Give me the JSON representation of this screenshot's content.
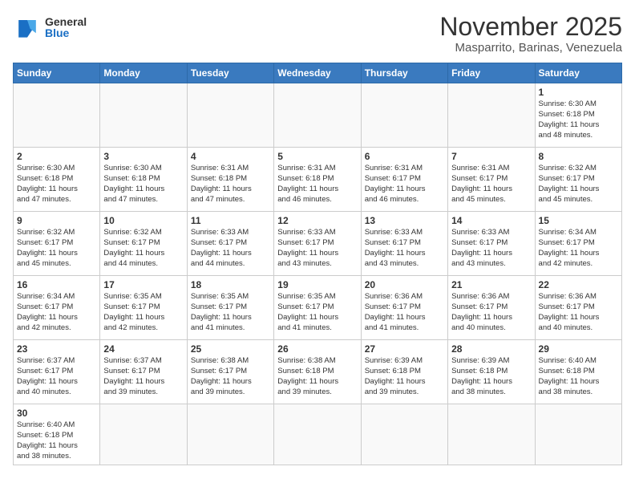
{
  "logo": {
    "general": "General",
    "blue": "Blue"
  },
  "header": {
    "month": "November 2025",
    "location": "Masparrito, Barinas, Venezuela"
  },
  "weekdays": [
    "Sunday",
    "Monday",
    "Tuesday",
    "Wednesday",
    "Thursday",
    "Friday",
    "Saturday"
  ],
  "weeks": [
    [
      {
        "day": "",
        "info": ""
      },
      {
        "day": "",
        "info": ""
      },
      {
        "day": "",
        "info": ""
      },
      {
        "day": "",
        "info": ""
      },
      {
        "day": "",
        "info": ""
      },
      {
        "day": "",
        "info": ""
      },
      {
        "day": "1",
        "info": "Sunrise: 6:30 AM\nSunset: 6:18 PM\nDaylight: 11 hours\nand 48 minutes."
      }
    ],
    [
      {
        "day": "2",
        "info": "Sunrise: 6:30 AM\nSunset: 6:18 PM\nDaylight: 11 hours\nand 47 minutes."
      },
      {
        "day": "3",
        "info": "Sunrise: 6:30 AM\nSunset: 6:18 PM\nDaylight: 11 hours\nand 47 minutes."
      },
      {
        "day": "4",
        "info": "Sunrise: 6:31 AM\nSunset: 6:18 PM\nDaylight: 11 hours\nand 47 minutes."
      },
      {
        "day": "5",
        "info": "Sunrise: 6:31 AM\nSunset: 6:18 PM\nDaylight: 11 hours\nand 46 minutes."
      },
      {
        "day": "6",
        "info": "Sunrise: 6:31 AM\nSunset: 6:17 PM\nDaylight: 11 hours\nand 46 minutes."
      },
      {
        "day": "7",
        "info": "Sunrise: 6:31 AM\nSunset: 6:17 PM\nDaylight: 11 hours\nand 45 minutes."
      },
      {
        "day": "8",
        "info": "Sunrise: 6:32 AM\nSunset: 6:17 PM\nDaylight: 11 hours\nand 45 minutes."
      }
    ],
    [
      {
        "day": "9",
        "info": "Sunrise: 6:32 AM\nSunset: 6:17 PM\nDaylight: 11 hours\nand 45 minutes."
      },
      {
        "day": "10",
        "info": "Sunrise: 6:32 AM\nSunset: 6:17 PM\nDaylight: 11 hours\nand 44 minutes."
      },
      {
        "day": "11",
        "info": "Sunrise: 6:33 AM\nSunset: 6:17 PM\nDaylight: 11 hours\nand 44 minutes."
      },
      {
        "day": "12",
        "info": "Sunrise: 6:33 AM\nSunset: 6:17 PM\nDaylight: 11 hours\nand 43 minutes."
      },
      {
        "day": "13",
        "info": "Sunrise: 6:33 AM\nSunset: 6:17 PM\nDaylight: 11 hours\nand 43 minutes."
      },
      {
        "day": "14",
        "info": "Sunrise: 6:33 AM\nSunset: 6:17 PM\nDaylight: 11 hours\nand 43 minutes."
      },
      {
        "day": "15",
        "info": "Sunrise: 6:34 AM\nSunset: 6:17 PM\nDaylight: 11 hours\nand 42 minutes."
      }
    ],
    [
      {
        "day": "16",
        "info": "Sunrise: 6:34 AM\nSunset: 6:17 PM\nDaylight: 11 hours\nand 42 minutes."
      },
      {
        "day": "17",
        "info": "Sunrise: 6:35 AM\nSunset: 6:17 PM\nDaylight: 11 hours\nand 42 minutes."
      },
      {
        "day": "18",
        "info": "Sunrise: 6:35 AM\nSunset: 6:17 PM\nDaylight: 11 hours\nand 41 minutes."
      },
      {
        "day": "19",
        "info": "Sunrise: 6:35 AM\nSunset: 6:17 PM\nDaylight: 11 hours\nand 41 minutes."
      },
      {
        "day": "20",
        "info": "Sunrise: 6:36 AM\nSunset: 6:17 PM\nDaylight: 11 hours\nand 41 minutes."
      },
      {
        "day": "21",
        "info": "Sunrise: 6:36 AM\nSunset: 6:17 PM\nDaylight: 11 hours\nand 40 minutes."
      },
      {
        "day": "22",
        "info": "Sunrise: 6:36 AM\nSunset: 6:17 PM\nDaylight: 11 hours\nand 40 minutes."
      }
    ],
    [
      {
        "day": "23",
        "info": "Sunrise: 6:37 AM\nSunset: 6:17 PM\nDaylight: 11 hours\nand 40 minutes."
      },
      {
        "day": "24",
        "info": "Sunrise: 6:37 AM\nSunset: 6:17 PM\nDaylight: 11 hours\nand 39 minutes."
      },
      {
        "day": "25",
        "info": "Sunrise: 6:38 AM\nSunset: 6:17 PM\nDaylight: 11 hours\nand 39 minutes."
      },
      {
        "day": "26",
        "info": "Sunrise: 6:38 AM\nSunset: 6:18 PM\nDaylight: 11 hours\nand 39 minutes."
      },
      {
        "day": "27",
        "info": "Sunrise: 6:39 AM\nSunset: 6:18 PM\nDaylight: 11 hours\nand 39 minutes."
      },
      {
        "day": "28",
        "info": "Sunrise: 6:39 AM\nSunset: 6:18 PM\nDaylight: 11 hours\nand 38 minutes."
      },
      {
        "day": "29",
        "info": "Sunrise: 6:40 AM\nSunset: 6:18 PM\nDaylight: 11 hours\nand 38 minutes."
      }
    ],
    [
      {
        "day": "30",
        "info": "Sunrise: 6:40 AM\nSunset: 6:18 PM\nDaylight: 11 hours\nand 38 minutes."
      },
      {
        "day": "",
        "info": ""
      },
      {
        "day": "",
        "info": ""
      },
      {
        "day": "",
        "info": ""
      },
      {
        "day": "",
        "info": ""
      },
      {
        "day": "",
        "info": ""
      },
      {
        "day": "",
        "info": ""
      }
    ]
  ]
}
